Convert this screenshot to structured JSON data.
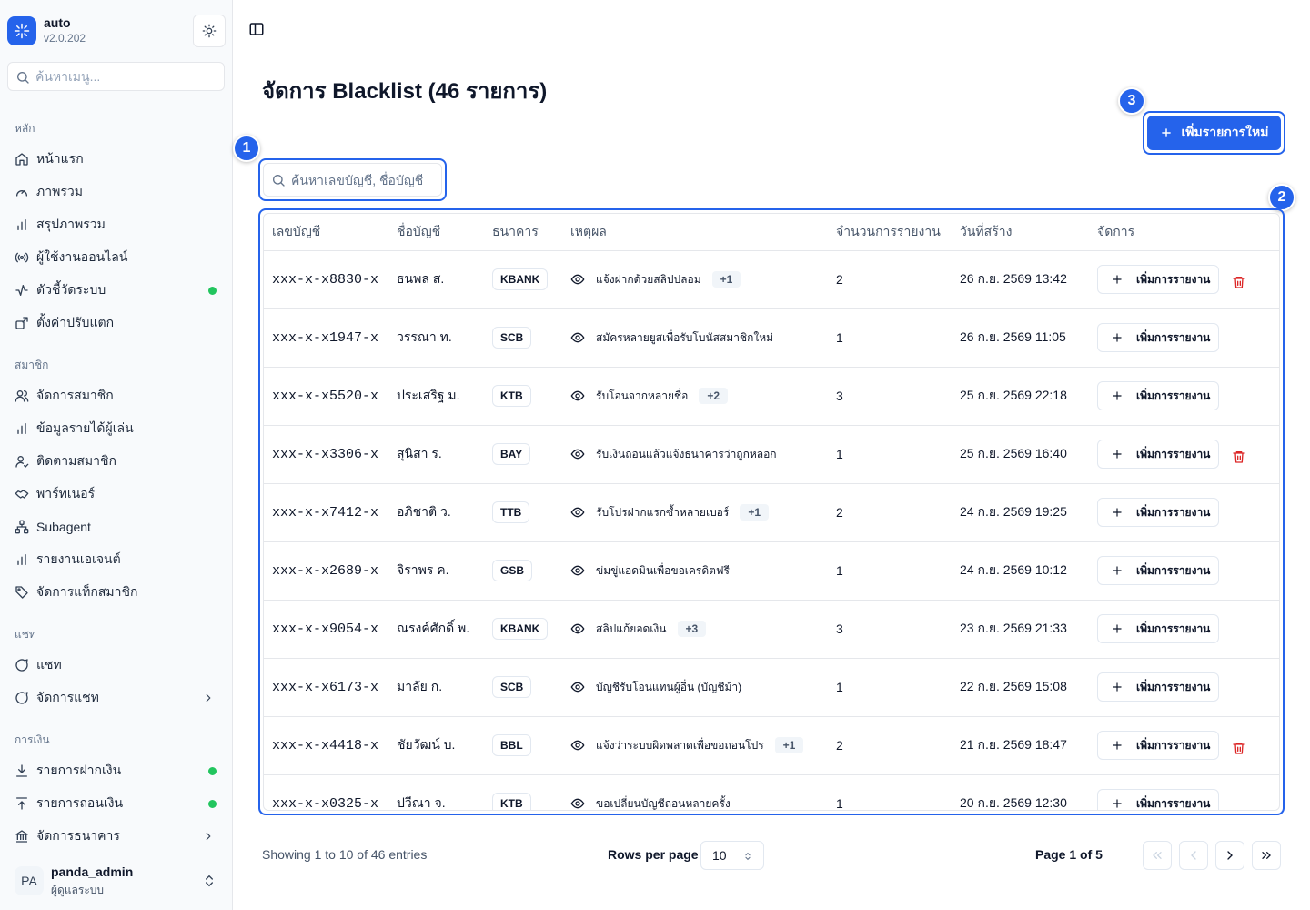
{
  "app": {
    "name": "auto",
    "version": "v2.0.202"
  },
  "sidebar": {
    "search_placeholder": "ค้นหาเมนู...",
    "sections": [
      {
        "label": "หลัก",
        "items": [
          {
            "label": "หน้าแรก",
            "icon": "home-icon"
          },
          {
            "label": "ภาพรวม",
            "icon": "gauge-icon"
          },
          {
            "label": "สรุปภาพรวม",
            "icon": "bar-chart-icon"
          },
          {
            "label": "ผู้ใช้งานออนไลน์",
            "icon": "radio-icon"
          },
          {
            "label": "ตัวชี้วัดระบบ",
            "icon": "activity-icon",
            "status": "online"
          },
          {
            "label": "ตั้งค่าปรับแตก",
            "icon": "settings-share-icon"
          }
        ]
      },
      {
        "label": "สมาชิก",
        "items": [
          {
            "label": "จัดการสมาชิก",
            "icon": "users-icon"
          },
          {
            "label": "ข้อมูลรายได้ผู้เล่น",
            "icon": "bar-chart-icon"
          },
          {
            "label": "ติดตามสมาชิก",
            "icon": "user-check-icon"
          },
          {
            "label": "พาร์ทเนอร์",
            "icon": "handshake-icon"
          },
          {
            "label": "Subagent",
            "icon": "network-icon"
          },
          {
            "label": "รายงานเอเจนต์",
            "icon": "bar-chart-icon"
          },
          {
            "label": "จัดการแท็กสมาชิก",
            "icon": "tag-icon"
          }
        ]
      },
      {
        "label": "แชท",
        "items": [
          {
            "label": "แชท",
            "icon": "message-icon"
          },
          {
            "label": "จัดการแชท",
            "icon": "message-icon",
            "expandable": true
          }
        ]
      },
      {
        "label": "การเงิน",
        "items": [
          {
            "label": "รายการฝากเงิน",
            "icon": "download-icon",
            "status": "online"
          },
          {
            "label": "รายการถอนเงิน",
            "icon": "upload-icon",
            "status": "online"
          },
          {
            "label": "จัดการธนาคาร",
            "icon": "bank-icon",
            "expandable": true
          }
        ]
      }
    ],
    "user": {
      "initials": "PA",
      "name": "panda_admin",
      "role": "ผู้ดูแลระบบ"
    }
  },
  "page": {
    "title": "จัดการ Blacklist (46 รายการ)",
    "search_placeholder": "ค้นหาเลขบัญชี, ชื่อบัญชี",
    "add_button": "เพิ่มรายการใหม่",
    "badges": [
      "1",
      "2",
      "3"
    ],
    "accent_color": "#2563eb",
    "delete_color": "#dc2626",
    "status_color": "#22c55e"
  },
  "table": {
    "columns": [
      "เลขบัญชี",
      "ชื่อบัญชี",
      "ธนาคาร",
      "เหตุผล",
      "จำนวนการรายงาน",
      "วันที่สร้าง",
      "จัดการ"
    ],
    "report_button": "เพิ่มการรายงาน",
    "rows": [
      {
        "account": "xxx-x-x8830-x",
        "name": "ธนพล ส.",
        "bank": "KBANK",
        "reason": "แจ้งฝากด้วยสลิปปลอม",
        "more": "+1",
        "reports": "2",
        "created": "26 ก.ย. 2569 13:42",
        "deletable": true
      },
      {
        "account": "xxx-x-x1947-x",
        "name": "วรรณา ท.",
        "bank": "SCB",
        "reason": "สมัครหลายยูสเพื่อรับโบนัสสมาชิกใหม่",
        "more": "",
        "reports": "1",
        "created": "26 ก.ย. 2569 11:05",
        "deletable": false
      },
      {
        "account": "xxx-x-x5520-x",
        "name": "ประเสริฐ ม.",
        "bank": "KTB",
        "reason": "รับโอนจากหลายชื่อ",
        "more": "+2",
        "reports": "3",
        "created": "25 ก.ย. 2569 22:18",
        "deletable": false
      },
      {
        "account": "xxx-x-x3306-x",
        "name": "สุนิสา ร.",
        "bank": "BAY",
        "reason": "รับเงินถอนแล้วแจ้งธนาคารว่าถูกหลอก",
        "more": "",
        "reports": "1",
        "created": "25 ก.ย. 2569 16:40",
        "deletable": true
      },
      {
        "account": "xxx-x-x7412-x",
        "name": "อภิชาติ ว.",
        "bank": "TTB",
        "reason": "รับโปรฝากแรกซ้ำหลายเบอร์",
        "more": "+1",
        "reports": "2",
        "created": "24 ก.ย. 2569 19:25",
        "deletable": false
      },
      {
        "account": "xxx-x-x2689-x",
        "name": "จิราพร ค.",
        "bank": "GSB",
        "reason": "ข่มขู่แอดมินเพื่อขอเครดิตฟรี",
        "more": "",
        "reports": "1",
        "created": "24 ก.ย. 2569 10:12",
        "deletable": false
      },
      {
        "account": "xxx-x-x9054-x",
        "name": "ณรงค์ศักดิ์ พ.",
        "bank": "KBANK",
        "reason": "สลิปแก้ยอดเงิน",
        "more": "+3",
        "reports": "3",
        "created": "23 ก.ย. 2569 21:33",
        "deletable": false
      },
      {
        "account": "xxx-x-x6173-x",
        "name": "มาลัย ก.",
        "bank": "SCB",
        "reason": "บัญชีรับโอนแทนผู้อื่น (บัญชีม้า)",
        "more": "",
        "reports": "1",
        "created": "22 ก.ย. 2569 15:08",
        "deletable": false
      },
      {
        "account": "xxx-x-x4418-x",
        "name": "ชัยวัฒน์ บ.",
        "bank": "BBL",
        "reason": "แจ้งว่าระบบผิดพลาดเพื่อขอถอนโปร",
        "more": "+1",
        "reports": "2",
        "created": "21 ก.ย. 2569 18:47",
        "deletable": true
      },
      {
        "account": "xxx-x-x0325-x",
        "name": "ปวีณา จ.",
        "bank": "KTB",
        "reason": "ขอเปลี่ยนบัญชีถอนหลายครั้ง",
        "more": "",
        "reports": "1",
        "created": "20 ก.ย. 2569 12:30",
        "deletable": false
      }
    ]
  },
  "footer": {
    "showing": "Showing 1 to 10 of 46 entries",
    "rows_per_page_label": "Rows per page",
    "rows_per_page": "10",
    "page_info": "Page 1 of 5"
  }
}
